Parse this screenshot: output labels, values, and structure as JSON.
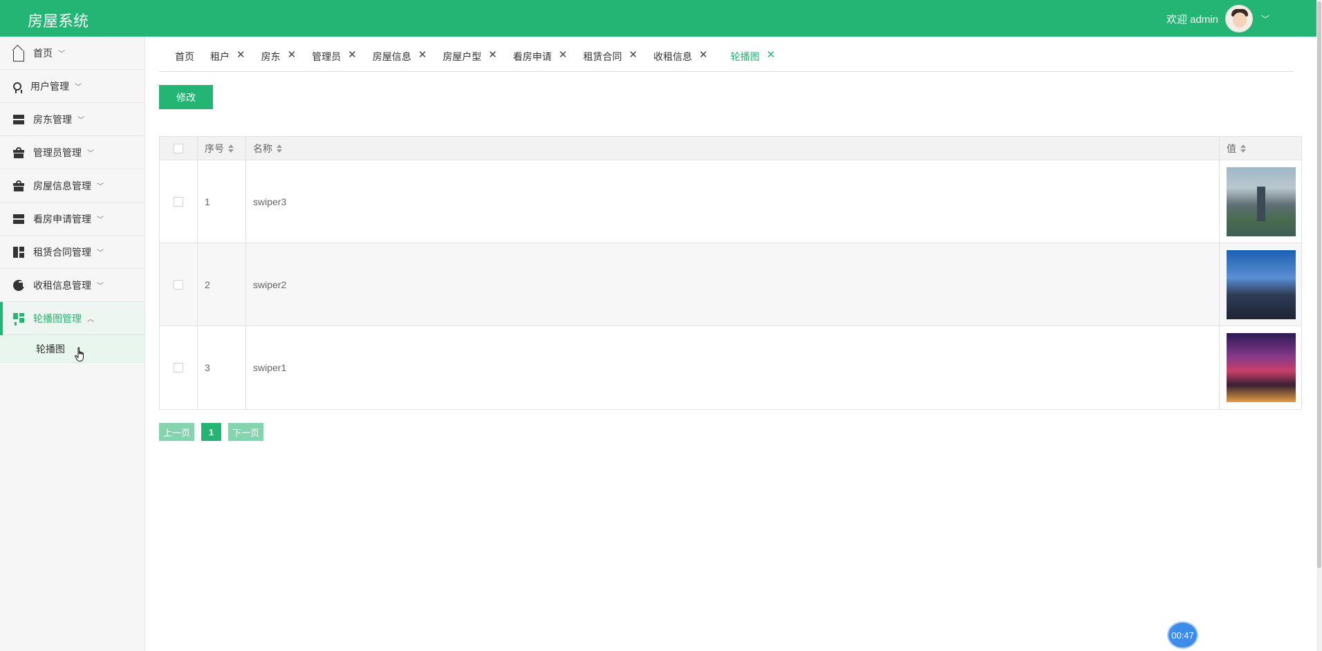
{
  "app": {
    "title": "房屋系统",
    "welcome": "欢迎 admin"
  },
  "sidebar": {
    "items": [
      {
        "label": "首页",
        "icon": "home-icon"
      },
      {
        "label": "用户管理",
        "icon": "medal-icon"
      },
      {
        "label": "房东管理",
        "icon": "server-icon"
      },
      {
        "label": "管理员管理",
        "icon": "gift-icon"
      },
      {
        "label": "房屋信息管理",
        "icon": "gift-icon"
      },
      {
        "label": "看房申请管理",
        "icon": "server-icon"
      },
      {
        "label": "租赁合同管理",
        "icon": "layout-icon"
      },
      {
        "label": "收租信息管理",
        "icon": "pie-icon"
      },
      {
        "label": "轮播图管理",
        "icon": "dashboard-icon",
        "active": true
      }
    ],
    "sub_items": [
      {
        "label": "轮播图"
      }
    ]
  },
  "tabs": [
    {
      "label": "首页",
      "closable": false
    },
    {
      "label": "租户",
      "closable": true
    },
    {
      "label": "房东",
      "closable": true
    },
    {
      "label": "管理员",
      "closable": true
    },
    {
      "label": "房屋信息",
      "closable": true
    },
    {
      "label": "房屋户型",
      "closable": true
    },
    {
      "label": "看房申请",
      "closable": true
    },
    {
      "label": "租赁合同",
      "closable": true
    },
    {
      "label": "收租信息",
      "closable": true
    },
    {
      "label": "轮播图",
      "closable": true,
      "active": true
    }
  ],
  "toolbar": {
    "edit_label": "修改"
  },
  "table": {
    "columns": [
      "序号",
      "名称",
      "值"
    ],
    "rows": [
      {
        "index": "1",
        "name": "swiper3"
      },
      {
        "index": "2",
        "name": "swiper2"
      },
      {
        "index": "3",
        "name": "swiper1"
      }
    ]
  },
  "pager": {
    "prev": "上一页",
    "current": "1",
    "next": "下一页"
  },
  "timer": "00:47",
  "colors": {
    "accent": "#23b574",
    "accent_light": "#86d3b0",
    "timer_bg": "#3c8de8"
  }
}
